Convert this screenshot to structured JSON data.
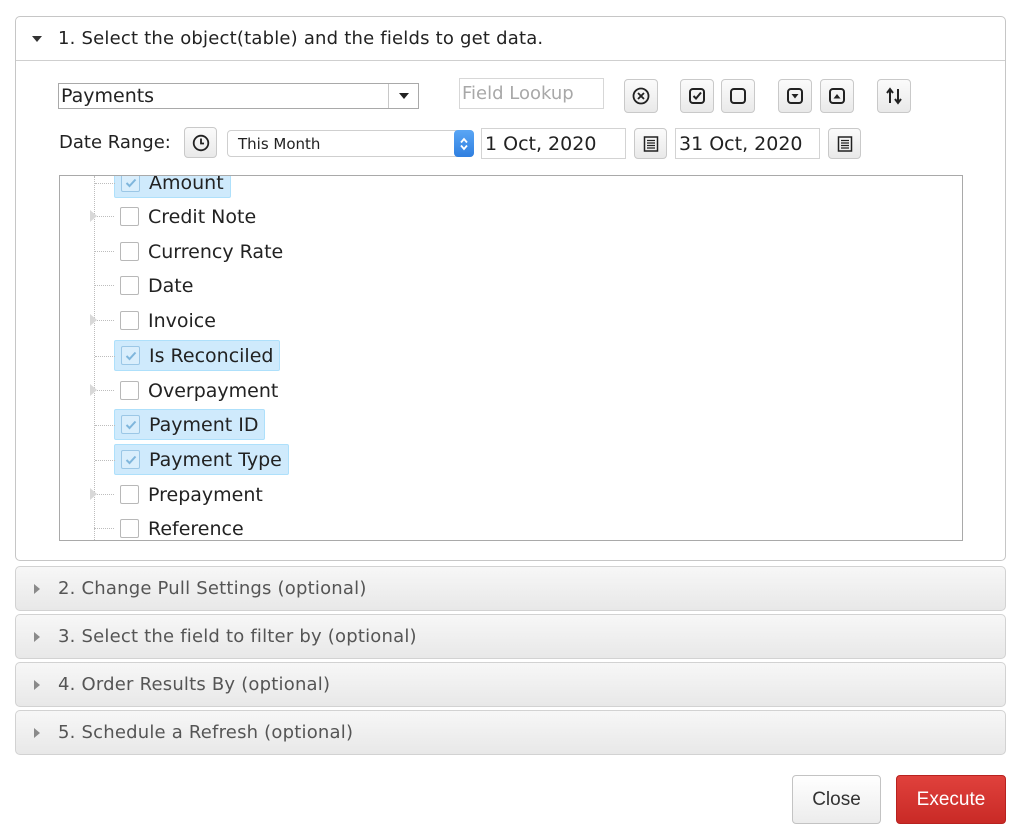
{
  "sections": {
    "s1": "1. Select the object(table) and the fields to get data.",
    "s2": "2. Change Pull Settings (optional)",
    "s3": "3. Select the field to filter by (optional)",
    "s4": "4. Order Results By (optional)",
    "s5": "5. Schedule a Refresh (optional)"
  },
  "object_select": {
    "value": "Payments"
  },
  "field_lookup": {
    "placeholder": "Field Lookup"
  },
  "icons": {
    "clear": "clear-circle-icon",
    "check_all": "check-all-icon",
    "uncheck_all": "uncheck-all-icon",
    "expand_all": "expand-all-icon",
    "collapse_all": "collapse-all-icon",
    "sort": "sort-icon",
    "clock": "clock-icon",
    "calendar": "calendar-icon"
  },
  "date_range": {
    "label": "Date Range:",
    "preset": "This Month",
    "from": "1 Oct, 2020",
    "to": "31 Oct, 2020"
  },
  "tree": {
    "items": [
      {
        "label": "Amount",
        "checked": true
      },
      {
        "label": "Credit Note",
        "checked": false,
        "expandable": true
      },
      {
        "label": "Currency Rate",
        "checked": false
      },
      {
        "label": "Date",
        "checked": false
      },
      {
        "label": "Invoice",
        "checked": false,
        "expandable": true
      },
      {
        "label": "Is Reconciled",
        "checked": true
      },
      {
        "label": "Overpayment",
        "checked": false,
        "expandable": true
      },
      {
        "label": "Payment ID",
        "checked": true
      },
      {
        "label": "Payment Type",
        "checked": true
      },
      {
        "label": "Prepayment",
        "checked": false,
        "expandable": true
      },
      {
        "label": "Reference",
        "checked": false
      }
    ]
  },
  "buttons": {
    "close": "Close",
    "execute": "Execute"
  },
  "colors": {
    "selected_bg": "#cfeafc",
    "execute_bg": "#d33430"
  }
}
